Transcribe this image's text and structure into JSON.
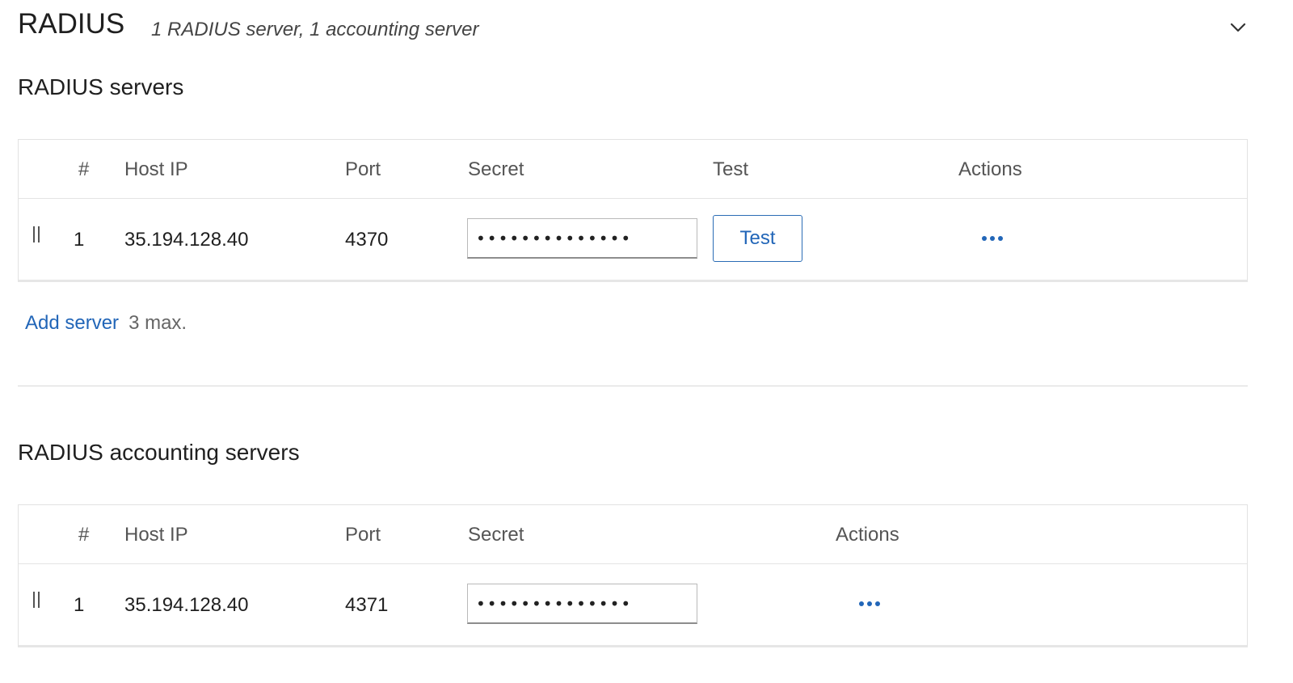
{
  "header": {
    "title": "RADIUS",
    "summary": "1 RADIUS server, 1 accounting server",
    "collapse_icon": "chevron-down-icon"
  },
  "radius_servers": {
    "title": "RADIUS servers",
    "columns": {
      "number": "#",
      "host_ip": "Host IP",
      "port": "Port",
      "secret": "Secret",
      "test": "Test",
      "actions": "Actions"
    },
    "rows": [
      {
        "number": "1",
        "host_ip": "35.194.128.40",
        "port": "4370",
        "secret": "••••••••••••••",
        "test_label": "Test",
        "actions_icon": "more-horizontal-icon"
      }
    ],
    "add_label": "Add server",
    "max_note": "3 max."
  },
  "accounting_servers": {
    "title": "RADIUS accounting servers",
    "columns": {
      "number": "#",
      "host_ip": "Host IP",
      "port": "Port",
      "secret": "Secret",
      "actions": "Actions"
    },
    "rows": [
      {
        "number": "1",
        "host_ip": "35.194.128.40",
        "port": "4371",
        "secret": "••••••••••••••",
        "actions_icon": "more-horizontal-icon"
      }
    ]
  },
  "colors": {
    "accent": "#2266b8",
    "border": "#e2e2e2",
    "text": "#1f1f1f"
  }
}
